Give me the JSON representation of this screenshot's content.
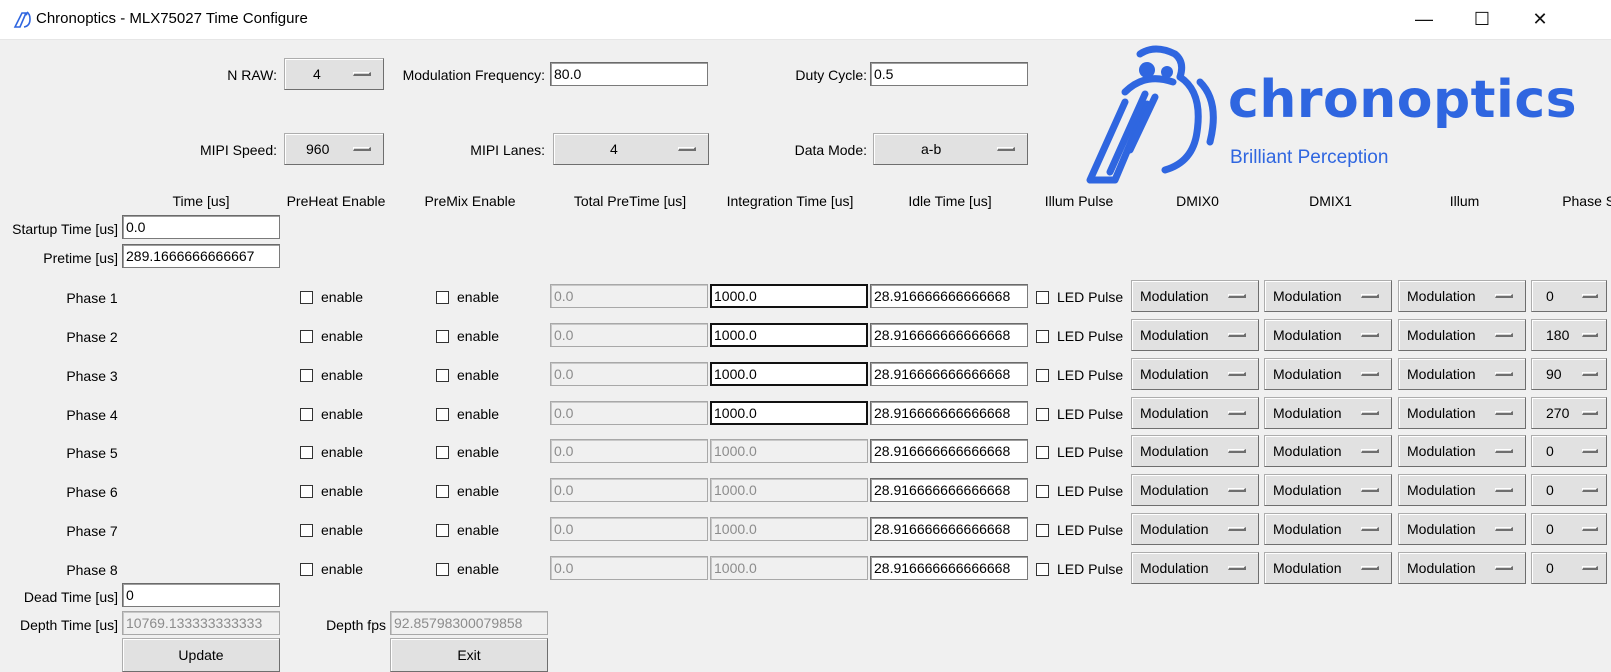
{
  "window": {
    "title": "Chronoptics - MLX75027 Time Configure",
    "controls": {
      "minimize": "—",
      "maximize": "☐",
      "close": "✕"
    }
  },
  "logo": {
    "wordmark": "chronoptics",
    "tagline": "Brilliant Perception",
    "color": "#2f66e0"
  },
  "top": {
    "nraw_label": "N RAW:",
    "nraw_value": "4",
    "modfreq_label": "Modulation Frequency:",
    "modfreq_value": "80.0",
    "duty_label": "Duty Cycle:",
    "duty_value": "0.5",
    "mipi_speed_label": "MIPI Speed:",
    "mipi_speed_value": "960",
    "mipi_lanes_label": "MIPI Lanes:",
    "mipi_lanes_value": "4",
    "data_mode_label": "Data Mode:",
    "data_mode_value": "a-b"
  },
  "headers": {
    "time": "Time [us]",
    "preheat": "PreHeat Enable",
    "premix": "PreMix Enable",
    "total_pretime": "Total PreTime [us]",
    "integration": "Integration Time [us]",
    "idle": "Idle Time [us]",
    "illum_pulse": "Illum Pulse",
    "dmix0": "DMIX0",
    "dmix1": "DMIX1",
    "illum": "Illum",
    "phase_shift": "Phase Shift"
  },
  "startup": {
    "label": "Startup Time [us]",
    "value": "0.0"
  },
  "pretime": {
    "label": "Pretime [us]",
    "value": "289.1666666666667"
  },
  "phase_checkbox_label": "enable",
  "led_label": "LED Pulse",
  "phases": [
    {
      "name": "Phase 1",
      "total_pretime": "0.0",
      "integration": "1000.0",
      "idle": "28.916666666666668",
      "dmix0": "Modulation",
      "dmix1": "Modulation",
      "illum": "Modulation",
      "phase_shift": "0"
    },
    {
      "name": "Phase 2",
      "total_pretime": "0.0",
      "integration": "1000.0",
      "idle": "28.916666666666668",
      "dmix0": "Modulation",
      "dmix1": "Modulation",
      "illum": "Modulation",
      "phase_shift": "180"
    },
    {
      "name": "Phase 3",
      "total_pretime": "0.0",
      "integration": "1000.0",
      "idle": "28.916666666666668",
      "dmix0": "Modulation",
      "dmix1": "Modulation",
      "illum": "Modulation",
      "phase_shift": "90"
    },
    {
      "name": "Phase 4",
      "total_pretime": "0.0",
      "integration": "1000.0",
      "idle": "28.916666666666668",
      "dmix0": "Modulation",
      "dmix1": "Modulation",
      "illum": "Modulation",
      "phase_shift": "270"
    },
    {
      "name": "Phase 5",
      "total_pretime": "0.0",
      "integration": "1000.0",
      "idle": "28.916666666666668",
      "dmix0": "Modulation",
      "dmix1": "Modulation",
      "illum": "Modulation",
      "phase_shift": "0"
    },
    {
      "name": "Phase 6",
      "total_pretime": "0.0",
      "integration": "1000.0",
      "idle": "28.916666666666668",
      "dmix0": "Modulation",
      "dmix1": "Modulation",
      "illum": "Modulation",
      "phase_shift": "0"
    },
    {
      "name": "Phase 7",
      "total_pretime": "0.0",
      "integration": "1000.0",
      "idle": "28.916666666666668",
      "dmix0": "Modulation",
      "dmix1": "Modulation",
      "illum": "Modulation",
      "phase_shift": "0"
    },
    {
      "name": "Phase 8",
      "total_pretime": "0.0",
      "integration": "1000.0",
      "idle": "28.916666666666668",
      "dmix0": "Modulation",
      "dmix1": "Modulation",
      "illum": "Modulation",
      "phase_shift": "0"
    }
  ],
  "dead_time": {
    "label": "Dead Time [us]",
    "value": "0"
  },
  "depth_time": {
    "label": "Depth Time [us]",
    "value": "10769.133333333333"
  },
  "depth_fps": {
    "label": "Depth fps",
    "value": "92.85798300079858"
  },
  "buttons": {
    "update": "Update",
    "exit": "Exit"
  }
}
